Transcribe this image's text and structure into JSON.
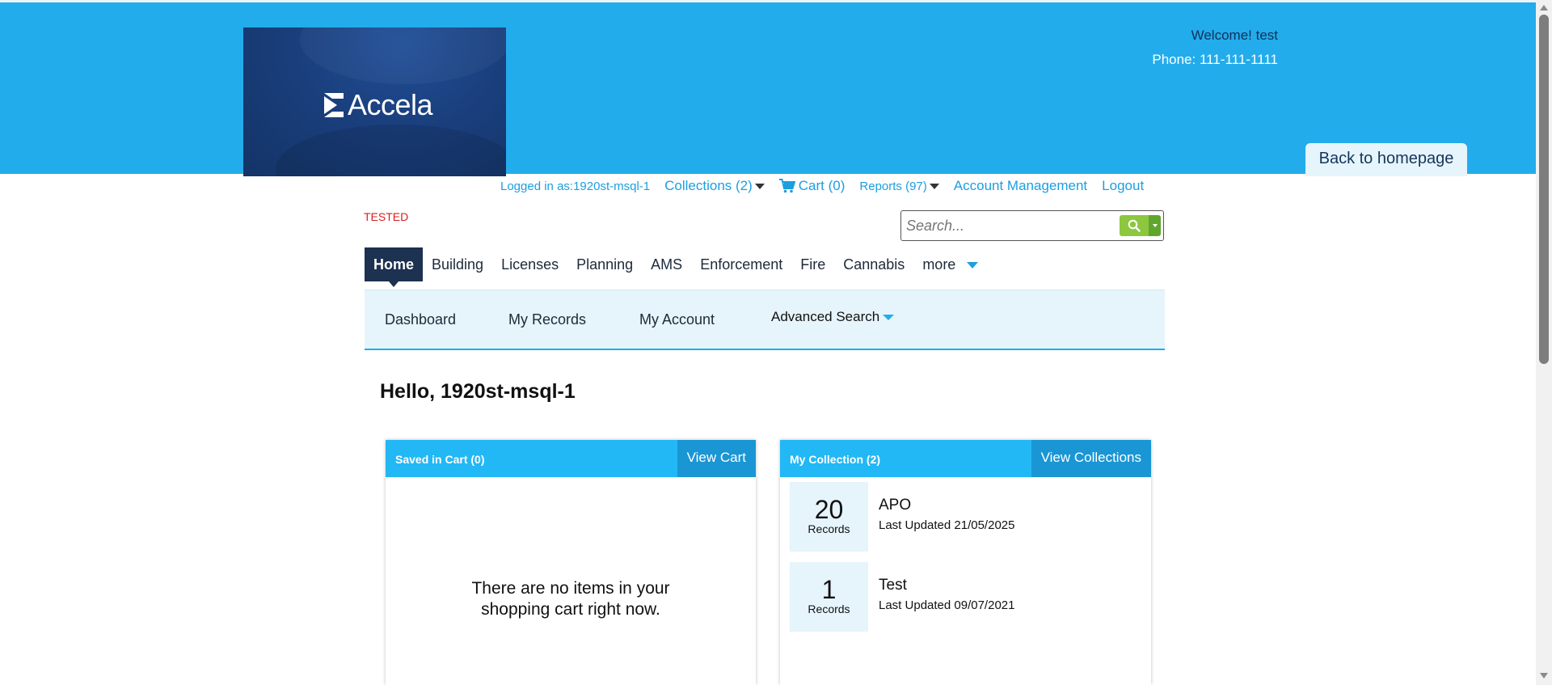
{
  "header": {
    "logo_text": "Accela",
    "welcome": "Welcome! test",
    "phone": "Phone: 111-111-1111",
    "back_home": "Back to homepage"
  },
  "toplinks": {
    "logged_in": "Logged in as:1920st-msql-1",
    "collections": "Collections (2)",
    "cart": "Cart (0)",
    "reports": "Reports (97)",
    "account": "Account Management",
    "logout": "Logout"
  },
  "tested_label": "TESTED",
  "search": {
    "placeholder": "Search...",
    "value": ""
  },
  "mainnav": {
    "items": [
      "Home",
      "Building",
      "Licenses",
      "Planning",
      "AMS",
      "Enforcement",
      "Fire",
      "Cannabis",
      "more"
    ]
  },
  "subnav": {
    "dashboard": "Dashboard",
    "my_records": "My Records",
    "my_account": "My Account",
    "advanced_search": "Advanced Search"
  },
  "greeting": "Hello, 1920st-msql-1",
  "cart_panel": {
    "title": "Saved in Cart (0)",
    "button": "View Cart",
    "empty_line1": "There are no items in your",
    "empty_line2": "shopping cart right now."
  },
  "collection_panel": {
    "title": "My Collection (2)",
    "button": "View Collections",
    "items": [
      {
        "count": "20",
        "count_label": "Records",
        "name": "APO",
        "updated": "Last Updated 21/05/2025"
      },
      {
        "count": "1",
        "count_label": "Records",
        "name": "Test",
        "updated": "Last Updated 09/07/2021"
      }
    ]
  },
  "colors": {
    "header_blue": "#22acec",
    "nav_dark": "#1d3150",
    "panel_header": "#22b8f5",
    "subnav_bg": "#e6f4fb",
    "tested_red": "#d71f1f",
    "search_green": "#8dc63f"
  }
}
